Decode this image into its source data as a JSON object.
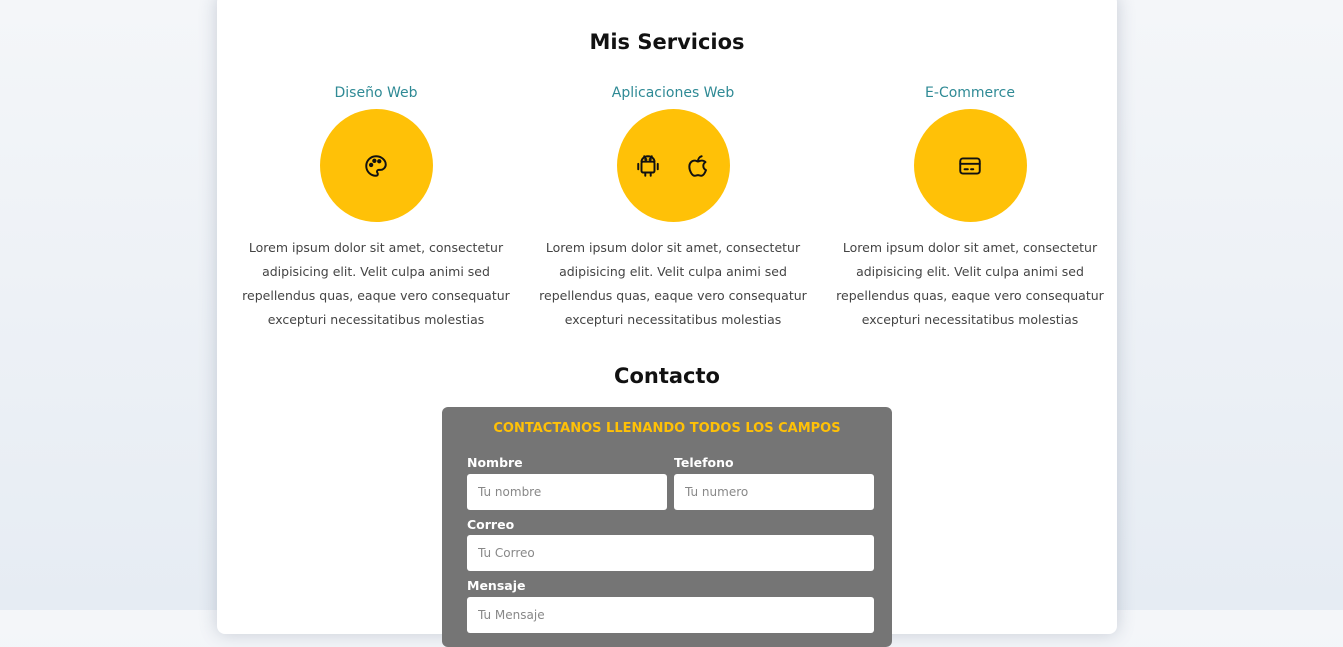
{
  "colors": {
    "accent": "#ffc107",
    "service_title": "#2f8a95",
    "form_bg": "#757575",
    "form_heading": "#ffc107"
  },
  "services": {
    "title": "Mis Servicios",
    "items": [
      {
        "name": "Diseño Web",
        "icons": [
          "palette-icon"
        ],
        "description": "Lorem ipsum dolor sit amet, consectetur adipisicing elit. Velit culpa animi sed repellendus quas, eaque vero consequatur excepturi necessitatibus molestias"
      },
      {
        "name": "Aplicaciones Web",
        "icons": [
          "android-icon",
          "apple-icon"
        ],
        "description": "Lorem ipsum dolor sit amet, consectetur adipisicing elit. Velit culpa animi sed repellendus quas, eaque vero consequatur excepturi necessitatibus molestias"
      },
      {
        "name": "E-Commerce",
        "icons": [
          "credit-card-icon"
        ],
        "description": "Lorem ipsum dolor sit amet, consectetur adipisicing elit. Velit culpa animi sed repellendus quas, eaque vero consequatur excepturi necessitatibus molestias"
      }
    ]
  },
  "contact": {
    "title": "Contacto",
    "form": {
      "heading": "CONTACTANOS LLENANDO TODOS LOS CAMPOS",
      "name_label": "Nombre",
      "name_placeholder": "Tu nombre",
      "phone_label": "Telefono",
      "phone_placeholder": "Tu numero",
      "email_label": "Correo",
      "email_placeholder": "Tu Correo",
      "message_label": "Mensaje",
      "message_placeholder": "Tu Mensaje"
    }
  }
}
